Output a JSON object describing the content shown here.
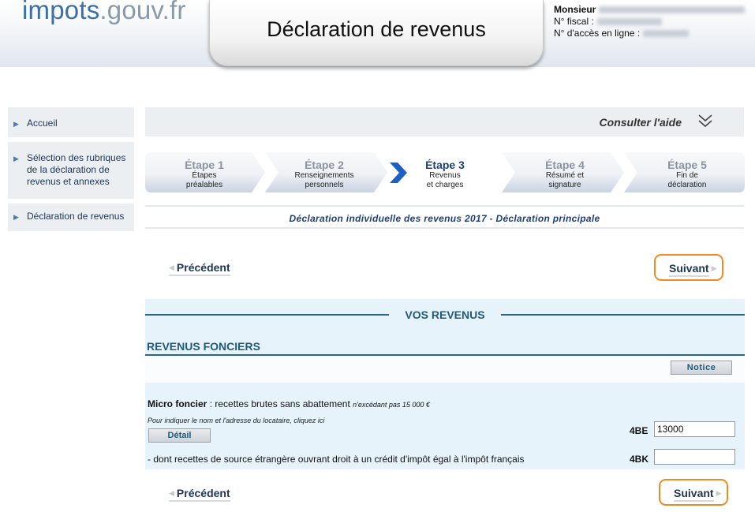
{
  "header": {
    "logo_part1": "impots",
    "logo_part2": ".gouv.fr",
    "title": "Déclaration de revenus",
    "user_name_label": "Monsieur",
    "fiscal_label": "N° fiscal :",
    "access_label": "N° d'accès en ligne :"
  },
  "sidebar": {
    "items": [
      {
        "label": "Accueil"
      },
      {
        "label": "Sélection des rubriques de la déclaration de revenus et annexes"
      },
      {
        "label": "Déclaration de revenus"
      }
    ]
  },
  "aide": {
    "label": "Consulter l'aide"
  },
  "steps": [
    {
      "num": "Étape 1",
      "line1": "Étapes",
      "line2": "préalables"
    },
    {
      "num": "Étape 2",
      "line1": "Renseignements",
      "line2": "personnels"
    },
    {
      "num": "Étape 3",
      "line1": "Revenus",
      "line2": "et charges"
    },
    {
      "num": "Étape 4",
      "line1": "Résumé et",
      "line2": "signature"
    },
    {
      "num": "Étape 5",
      "line1": "Fin de",
      "line2": "déclaration"
    }
  ],
  "declaration_title": "Déclaration individuelle des revenus 2017 - Déclaration principale",
  "nav": {
    "prev_label": "Précédent",
    "next_label": "Suivant"
  },
  "revenus": {
    "section_title": "VOS REVENUS",
    "subsection_title": "REVENUS FONCIERS",
    "notice_label": "Notice",
    "micro_label": "Micro foncier",
    "micro_text": " : recettes brutes sans abattement ",
    "micro_small": "n'excédant pas 15 000 €",
    "locataire_text": "Pour indiquer le nom et l'adresse du locataire, cliquez ici",
    "detail_label": "Détail",
    "field_4be": {
      "code": "4BE",
      "value": "13000"
    },
    "field_4bk": {
      "code": "4BK",
      "value": ""
    },
    "dont_text": "- dont recettes de source étrangère ouvrant droit à un crédit d'impôt égal à l'impôt français"
  },
  "colors": {
    "accent": "#f08a24",
    "navy": "#1d3557",
    "panel": "#e6f3fb"
  }
}
